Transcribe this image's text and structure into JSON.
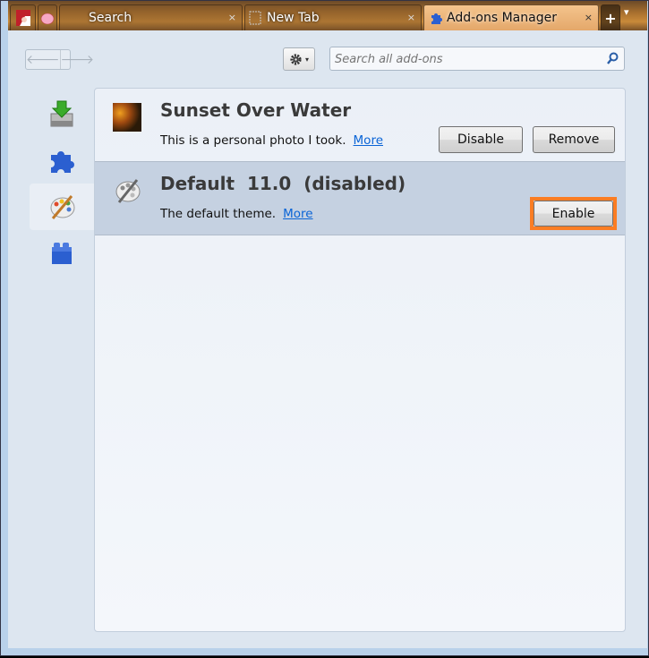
{
  "tabs": [
    {
      "label": "",
      "icon": "anime-avatar-icon"
    },
    {
      "label": "",
      "icon": "pink-blob-icon"
    },
    {
      "label": "Search",
      "icon": "none",
      "close": "×"
    },
    {
      "label": "New Tab",
      "icon": "blank-page-icon",
      "close": "×"
    },
    {
      "label": "Add-ons Manager",
      "icon": "puzzle-icon",
      "close": "×",
      "active": true
    }
  ],
  "new_tab_label": "+",
  "tab_list_label": "▾",
  "toolbar": {
    "back": "🡐",
    "forward": "🡒",
    "search_placeholder": "Search all add-ons"
  },
  "sidebar": {
    "items": [
      {
        "name": "get-addons",
        "icon": "download-tray-icon"
      },
      {
        "name": "extensions",
        "icon": "puzzle-icon"
      },
      {
        "name": "appearance",
        "icon": "palette-icon",
        "selected": true
      },
      {
        "name": "plugins",
        "icon": "lego-block-icon"
      }
    ]
  },
  "addons": [
    {
      "name": "Sunset Over Water",
      "description": "This is a personal photo I took.",
      "more": "More",
      "buttons": [
        "Disable",
        "Remove"
      ]
    },
    {
      "name": "Default  11.0  (disabled)",
      "description": "The default theme.",
      "more": "More",
      "buttons": [
        "Enable"
      ],
      "selected": true
    }
  ],
  "colors": {
    "highlight": "#fb7d23",
    "link": "#0a64d6",
    "selected_row": "#c5d1e1",
    "frame": "#b9d1ea"
  }
}
